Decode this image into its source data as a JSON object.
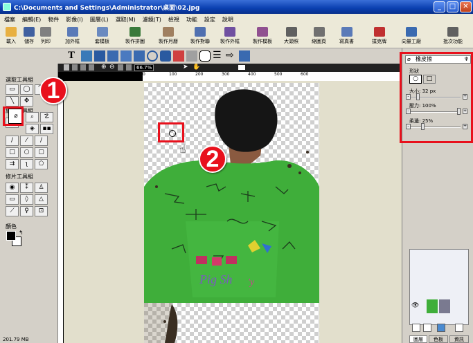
{
  "window": {
    "title": "C:\\Documents and Settings\\Administrator\\桌面\\02.jpg"
  },
  "menu": [
    "檔案",
    "編輯(E)",
    "物件",
    "影像(I)",
    "圖層(L)",
    "選取(M)",
    "濾鏡(T)",
    "檢視",
    "功能",
    "設定",
    "說明"
  ],
  "toolbar": [
    {
      "label": "載入",
      "icon": "folder-open-icon"
    },
    {
      "label": "儲存",
      "icon": "floppy-disk-icon"
    },
    {
      "label": "列印",
      "icon": "printer-icon"
    },
    {
      "label": "加外框",
      "icon": "frame-icon"
    },
    {
      "label": "套模板",
      "icon": "template-icon"
    },
    {
      "label": "製作拼圖",
      "icon": "puzzle-icon"
    },
    {
      "label": "製作月曆",
      "icon": "calendar-icon"
    },
    {
      "label": "製作對聯",
      "icon": "couplet-icon"
    },
    {
      "label": "製作外框",
      "icon": "frame-make-icon"
    },
    {
      "label": "製作模板",
      "icon": "template-make-icon"
    },
    {
      "label": "大頭照",
      "icon": "id-photo-icon"
    },
    {
      "label": "縮圖頁",
      "icon": "thumbnail-page-icon"
    },
    {
      "label": "寫真書",
      "icon": "photo-book-icon"
    },
    {
      "label": "撲克牌",
      "icon": "poker-icon"
    },
    {
      "label": "向量工廠",
      "icon": "vector-icon"
    },
    {
      "label": "批次功能",
      "icon": "batch-icon"
    }
  ],
  "zoom": "66.7%",
  "left_panel": {
    "select_group": "選取工具組",
    "paint_group": "繪圖工具組",
    "photo_group": "修片工具組",
    "color_label": "顏色",
    "status": "201.79 MB"
  },
  "ruler_ticks": [
    "0",
    "100",
    "200",
    "300",
    "400",
    "500",
    "600"
  ],
  "eraser_panel": {
    "title": "橡皮擦",
    "shape_label": "形狀",
    "size_label": "大小: 32 px",
    "opacity_label": "壓力: 100%",
    "softness_label": "柔邊: 25%",
    "size_value": 0.15,
    "pressure_value": 1.0,
    "softness_value": 0.25
  },
  "panel_tabs": [
    "圖層",
    "色板",
    "資訊"
  ],
  "annotations": [
    "1",
    "2"
  ],
  "colors": {
    "highlight": "#e8101c",
    "shirt": "#3fae3a",
    "titlebar": "#0a3fb0"
  }
}
